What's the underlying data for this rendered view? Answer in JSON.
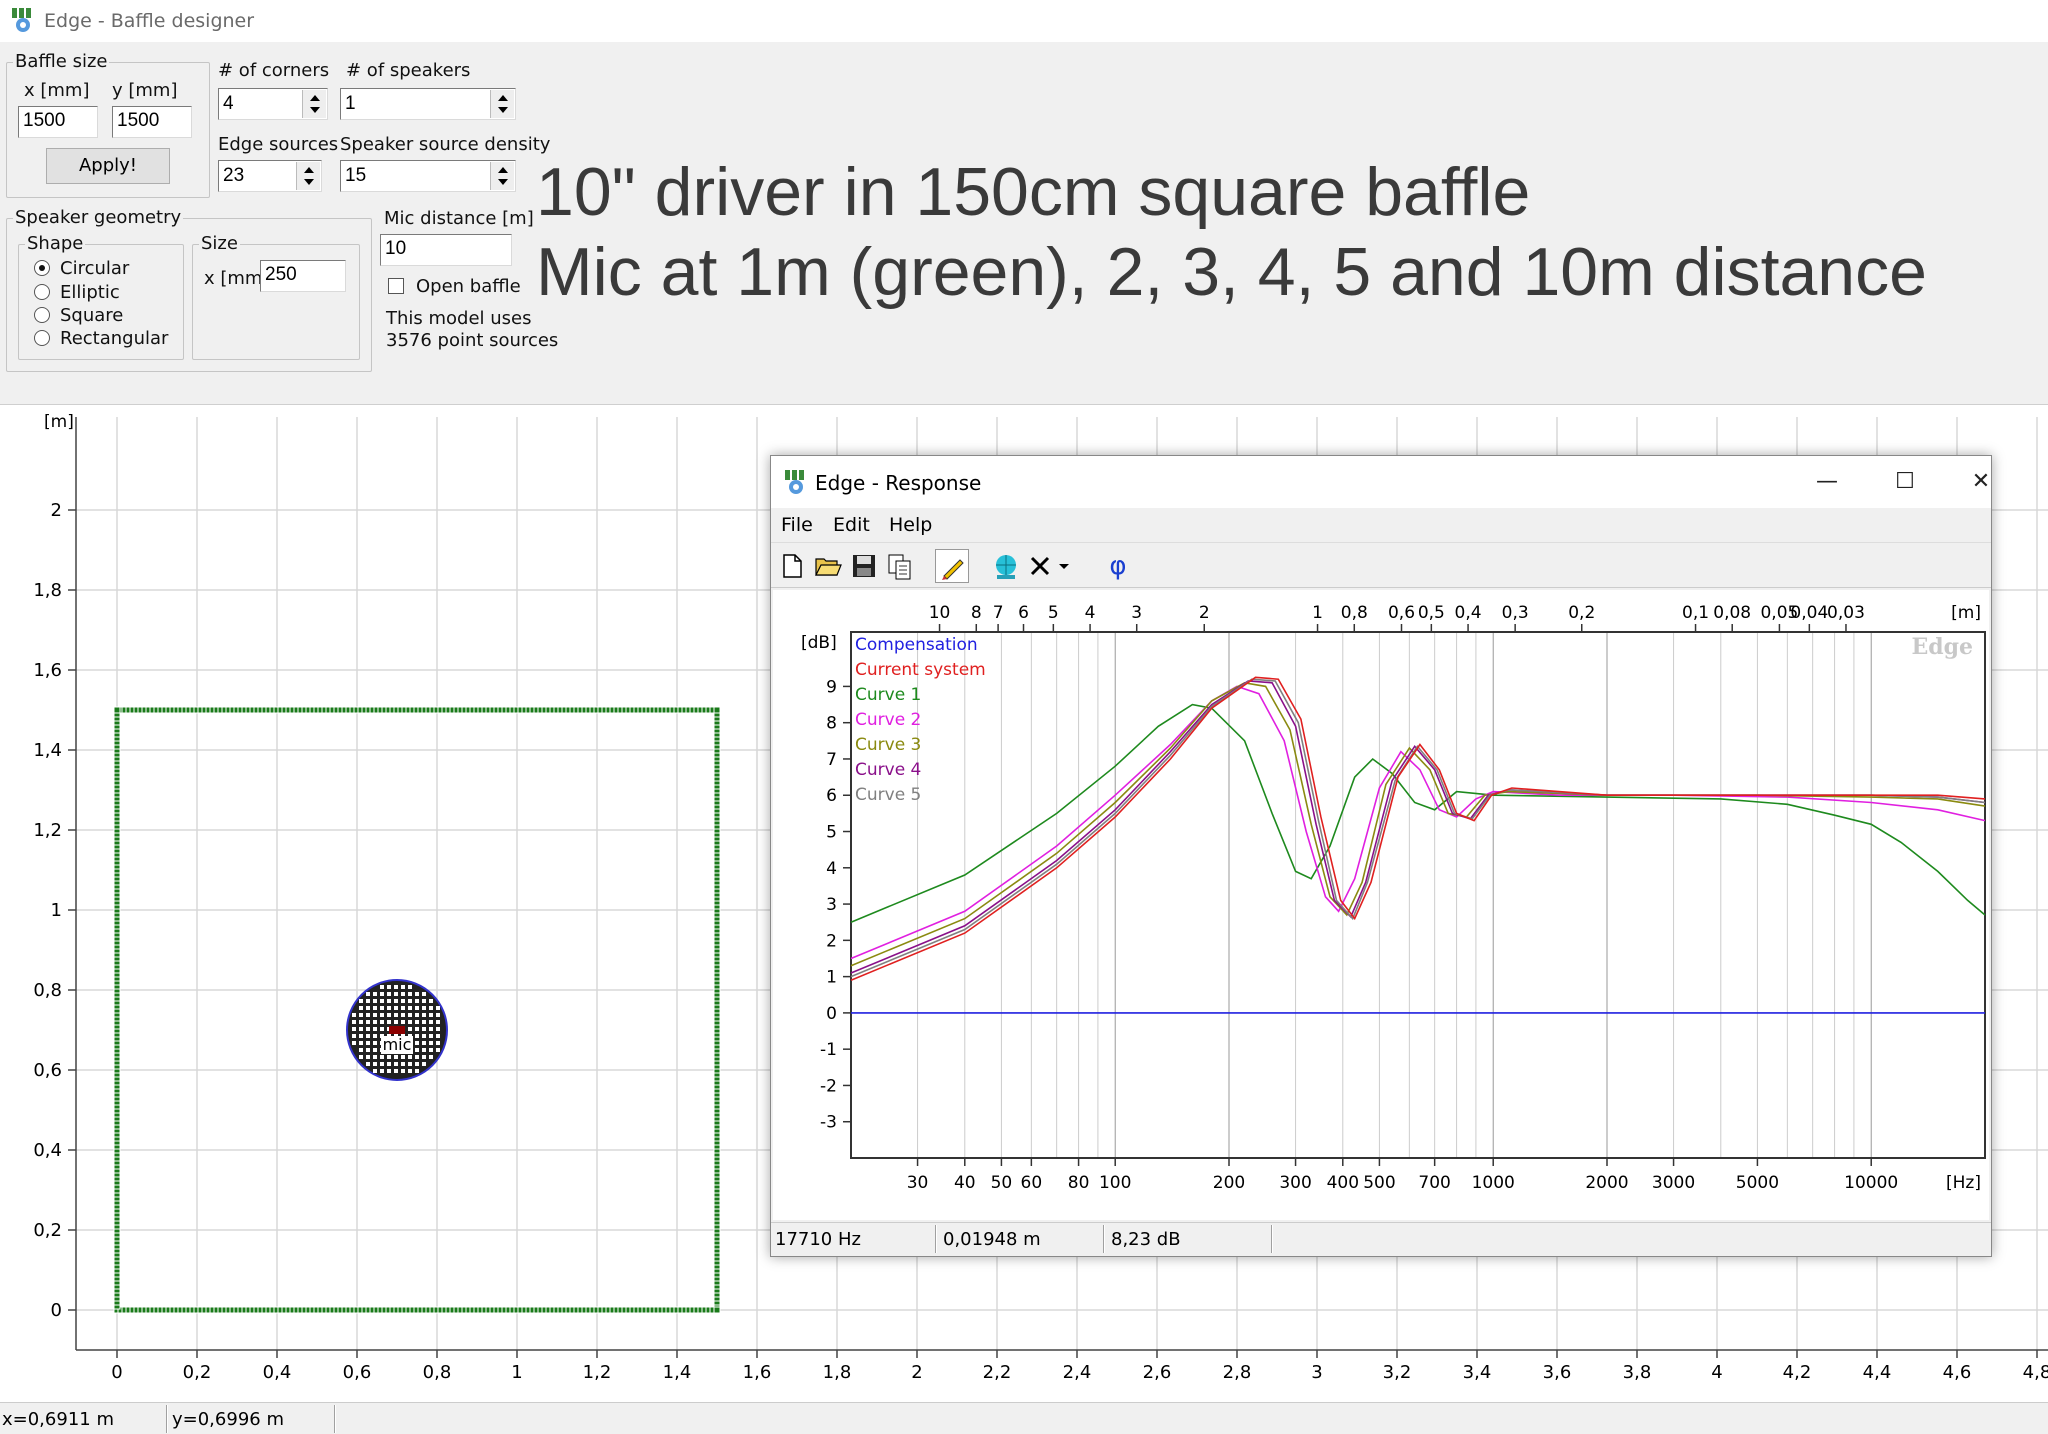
{
  "window": {
    "title": "Edge - Baffle designer"
  },
  "baffle_size": {
    "legend": "Baffle size",
    "x_label": "x [mm]",
    "y_label": "y [mm]",
    "x_value": "1500",
    "y_value": "1500",
    "apply_label": "Apply!"
  },
  "corners": {
    "label": "# of corners",
    "value": "4"
  },
  "speakers": {
    "label": "# of speakers",
    "value": "1"
  },
  "edge_sources": {
    "label": "Edge sources",
    "value": "23"
  },
  "speaker_density": {
    "label": "Speaker source density",
    "value": "15"
  },
  "speaker_geometry": {
    "legend": "Speaker geometry",
    "shape_legend": "Shape",
    "shapes": [
      {
        "label": "Circular",
        "selected": true
      },
      {
        "label": "Elliptic",
        "selected": false
      },
      {
        "label": "Square",
        "selected": false
      },
      {
        "label": "Rectangular",
        "selected": false
      }
    ],
    "size_legend": "Size",
    "size_x_label": "x [mm]",
    "size_x_value": "250"
  },
  "mic": {
    "label": "Mic distance [m]",
    "value": "10",
    "open_baffle_label": "Open baffle",
    "open_baffle_checked": false
  },
  "model_info": {
    "line1": "This model uses",
    "line2": "3576 point sources"
  },
  "annotation": {
    "line1": "10\" driver in 150cm square baffle",
    "line2": "Mic at 1m (green), 2, 3, 4, 5 and 10m distance"
  },
  "baffle_plot": {
    "y_unit": "[m]",
    "y_ticks": [
      "2",
      "1,8",
      "1,6",
      "1,4",
      "1,2",
      "1",
      "0,8",
      "0,6",
      "0,4",
      "0,2",
      "0"
    ],
    "x_ticks": [
      "0",
      "0,2",
      "0,4",
      "0,6",
      "0,8",
      "1",
      "1,2",
      "1,4",
      "1,6",
      "1,8",
      "2",
      "2,2",
      "2,4",
      "2,6",
      "2,8",
      "3",
      "3,2",
      "3,4",
      "3,6",
      "3,8",
      "4",
      "4,2",
      "4,4",
      "4,6",
      "4,8"
    ],
    "baffle_w_m": 1.5,
    "baffle_h_m": 1.5,
    "speaker_center_m": [
      0.7,
      0.7
    ],
    "speaker_diameter_m": 0.25,
    "mic_label": "mic",
    "colors": {
      "baffle": "#1a7a1a",
      "edge_red": "#e03030",
      "speaker_outline": "#3333cc"
    }
  },
  "status": {
    "x": "x=0,6911 m",
    "y": "y=0,6996 m"
  },
  "response_window": {
    "title": "Edge - Response",
    "buttons": {
      "minimize": "—",
      "maximize": "☐",
      "close": "✕"
    },
    "menu": [
      "File",
      "Edit",
      "Help"
    ],
    "status": {
      "freq": "17710 Hz",
      "wavelength": "0,01948 m",
      "level": "8,23 dB"
    },
    "tool_icons": [
      "new-icon",
      "open-icon",
      "save-icon",
      "copy-icon",
      "pen-icon",
      "globe-icon",
      "delete-icon",
      "dropdown-icon",
      "phase-icon"
    ],
    "phase_glyph": "φ"
  },
  "chart_data": {
    "type": "line",
    "watermark": "Edge",
    "ylabel": "[dB]",
    "xlabel": "[Hz]",
    "top_label": "[m]",
    "x_scale": "log",
    "xlim": [
      20,
      20000
    ],
    "ylim": [
      -4,
      10.5
    ],
    "x_ticks": [
      {
        "v": 30,
        "t": "30"
      },
      {
        "v": 40,
        "t": "40"
      },
      {
        "v": 50,
        "t": "50"
      },
      {
        "v": 60,
        "t": "60"
      },
      {
        "v": 80,
        "t": "80"
      },
      {
        "v": 100,
        "t": "100"
      },
      {
        "v": 200,
        "t": "200"
      },
      {
        "v": 300,
        "t": "300"
      },
      {
        "v": 400,
        "t": "400"
      },
      {
        "v": 500,
        "t": "500"
      },
      {
        "v": 700,
        "t": "700"
      },
      {
        "v": 1000,
        "t": "1000"
      },
      {
        "v": 2000,
        "t": "2000"
      },
      {
        "v": 3000,
        "t": "3000"
      },
      {
        "v": 5000,
        "t": "5000"
      },
      {
        "v": 10000,
        "t": "10000"
      }
    ],
    "y_ticks": [
      "9",
      "8",
      "7",
      "6",
      "5",
      "4",
      "3",
      "2",
      "1",
      "0",
      "-1",
      "-2",
      "-3"
    ],
    "wavelength_ticks": [
      {
        "f": 34.3,
        "t": "10"
      },
      {
        "f": 42.9,
        "t": "8"
      },
      {
        "f": 49,
        "t": "7"
      },
      {
        "f": 57.2,
        "t": "6"
      },
      {
        "f": 68.6,
        "t": "5"
      },
      {
        "f": 85.8,
        "t": "4"
      },
      {
        "f": 114,
        "t": "3"
      },
      {
        "f": 172,
        "t": "2"
      },
      {
        "f": 343,
        "t": "1"
      },
      {
        "f": 429,
        "t": "0,8"
      },
      {
        "f": 572,
        "t": "0,6"
      },
      {
        "f": 686,
        "t": "0,5"
      },
      {
        "f": 858,
        "t": "0,4"
      },
      {
        "f": 1143,
        "t": "0,3"
      },
      {
        "f": 1715,
        "t": "0,2"
      },
      {
        "f": 3430,
        "t": "0,1"
      },
      {
        "f": 4288,
        "t": "0,08"
      },
      {
        "f": 5717,
        "t": "0,05"
      },
      {
        "f": 6860,
        "t": "0,04"
      },
      {
        "f": 8575,
        "t": "0,03"
      }
    ],
    "legend": [
      {
        "name": "Compensation",
        "color": "#2020e0"
      },
      {
        "name": "Current system",
        "color": "#e02020"
      },
      {
        "name": "Curve 1",
        "color": "#1e8a1e"
      },
      {
        "name": "Curve 2",
        "color": "#e020e0"
      },
      {
        "name": "Curve 3",
        "color": "#8a8a10"
      },
      {
        "name": "Curve 4",
        "color": "#8a108a"
      },
      {
        "name": "Curve 5",
        "color": "#808080"
      }
    ],
    "series": [
      {
        "name": "Compensation",
        "color": "#2020e0",
        "points": [
          [
            20,
            0
          ],
          [
            20000,
            0
          ]
        ]
      },
      {
        "name": "Curve 1",
        "color": "#1e8a1e",
        "points": [
          [
            20,
            2.5
          ],
          [
            40,
            3.8
          ],
          [
            70,
            5.5
          ],
          [
            100,
            6.8
          ],
          [
            130,
            7.9
          ],
          [
            160,
            8.5
          ],
          [
            180,
            8.4
          ],
          [
            220,
            7.5
          ],
          [
            260,
            5.5
          ],
          [
            300,
            3.9
          ],
          [
            330,
            3.7
          ],
          [
            370,
            4.6
          ],
          [
            430,
            6.5
          ],
          [
            480,
            7
          ],
          [
            540,
            6.6
          ],
          [
            620,
            5.8
          ],
          [
            700,
            5.6
          ],
          [
            800,
            6.1
          ],
          [
            1000,
            6
          ],
          [
            2000,
            5.95
          ],
          [
            4000,
            5.9
          ],
          [
            6000,
            5.75
          ],
          [
            8000,
            5.45
          ],
          [
            10000,
            5.2
          ],
          [
            12000,
            4.7
          ],
          [
            15000,
            3.9
          ],
          [
            18000,
            3.1
          ],
          [
            20000,
            2.7
          ]
        ]
      },
      {
        "name": "Curve 2",
        "color": "#e020e0",
        "points": [
          [
            20,
            1.5
          ],
          [
            40,
            2.8
          ],
          [
            70,
            4.6
          ],
          [
            100,
            6
          ],
          [
            140,
            7.4
          ],
          [
            180,
            8.6
          ],
          [
            210,
            9
          ],
          [
            240,
            8.8
          ],
          [
            280,
            7.5
          ],
          [
            320,
            5
          ],
          [
            360,
            3.2
          ],
          [
            390,
            2.8
          ],
          [
            430,
            3.7
          ],
          [
            500,
            6.2
          ],
          [
            570,
            7.2
          ],
          [
            640,
            6.7
          ],
          [
            720,
            5.6
          ],
          [
            800,
            5.4
          ],
          [
            900,
            5.9
          ],
          [
            1000,
            6.1
          ],
          [
            1500,
            6
          ],
          [
            3000,
            6
          ],
          [
            6000,
            5.95
          ],
          [
            10000,
            5.8
          ],
          [
            15000,
            5.6
          ],
          [
            20000,
            5.3
          ]
        ]
      },
      {
        "name": "Curve 3",
        "color": "#8a8a10",
        "points": [
          [
            20,
            1.3
          ],
          [
            40,
            2.6
          ],
          [
            70,
            4.4
          ],
          [
            100,
            5.8
          ],
          [
            140,
            7.3
          ],
          [
            180,
            8.6
          ],
          [
            220,
            9.1
          ],
          [
            250,
            9
          ],
          [
            290,
            7.8
          ],
          [
            330,
            5.2
          ],
          [
            370,
            3.2
          ],
          [
            410,
            2.7
          ],
          [
            450,
            3.6
          ],
          [
            520,
            6.3
          ],
          [
            600,
            7.3
          ],
          [
            680,
            6.7
          ],
          [
            760,
            5.5
          ],
          [
            850,
            5.4
          ],
          [
            950,
            6
          ],
          [
            1100,
            6.1
          ],
          [
            2000,
            6
          ],
          [
            5000,
            6
          ],
          [
            10000,
            5.95
          ],
          [
            15000,
            5.9
          ],
          [
            20000,
            5.7
          ]
        ]
      },
      {
        "name": "Curve 4",
        "color": "#8a108a",
        "points": [
          [
            20,
            1.1
          ],
          [
            40,
            2.4
          ],
          [
            70,
            4.2
          ],
          [
            100,
            5.6
          ],
          [
            140,
            7.2
          ],
          [
            180,
            8.5
          ],
          [
            225,
            9.15
          ],
          [
            260,
            9.1
          ],
          [
            300,
            7.9
          ],
          [
            340,
            5.2
          ],
          [
            380,
            3.1
          ],
          [
            420,
            2.65
          ],
          [
            460,
            3.6
          ],
          [
            540,
            6.4
          ],
          [
            620,
            7.35
          ],
          [
            700,
            6.7
          ],
          [
            780,
            5.5
          ],
          [
            870,
            5.35
          ],
          [
            970,
            6
          ],
          [
            1100,
            6.15
          ],
          [
            2000,
            6
          ],
          [
            5000,
            6
          ],
          [
            10000,
            6
          ],
          [
            15000,
            5.95
          ],
          [
            20000,
            5.8
          ]
        ]
      },
      {
        "name": "Curve 5",
        "color": "#808080",
        "points": [
          [
            20,
            1
          ],
          [
            40,
            2.3
          ],
          [
            70,
            4.1
          ],
          [
            100,
            5.5
          ],
          [
            140,
            7.1
          ],
          [
            180,
            8.45
          ],
          [
            230,
            9.2
          ],
          [
            265,
            9.15
          ],
          [
            305,
            8
          ],
          [
            345,
            5.3
          ],
          [
            385,
            3.1
          ],
          [
            425,
            2.6
          ],
          [
            465,
            3.6
          ],
          [
            550,
            6.4
          ],
          [
            630,
            7.35
          ],
          [
            710,
            6.7
          ],
          [
            790,
            5.5
          ],
          [
            880,
            5.35
          ],
          [
            980,
            6
          ],
          [
            1100,
            6.15
          ],
          [
            2000,
            6
          ],
          [
            5000,
            6
          ],
          [
            10000,
            6
          ],
          [
            15000,
            5.95
          ],
          [
            20000,
            5.8
          ]
        ]
      },
      {
        "name": "Current system",
        "color": "#e02020",
        "points": [
          [
            20,
            0.9
          ],
          [
            40,
            2.2
          ],
          [
            70,
            4
          ],
          [
            100,
            5.4
          ],
          [
            140,
            7
          ],
          [
            180,
            8.4
          ],
          [
            235,
            9.25
          ],
          [
            270,
            9.2
          ],
          [
            310,
            8.1
          ],
          [
            350,
            5.4
          ],
          [
            395,
            3.1
          ],
          [
            430,
            2.6
          ],
          [
            475,
            3.6
          ],
          [
            560,
            6.5
          ],
          [
            640,
            7.4
          ],
          [
            720,
            6.7
          ],
          [
            800,
            5.5
          ],
          [
            890,
            5.3
          ],
          [
            990,
            6
          ],
          [
            1120,
            6.2
          ],
          [
            2000,
            6
          ],
          [
            5000,
            6
          ],
          [
            10000,
            6
          ],
          [
            15000,
            6
          ],
          [
            20000,
            5.9
          ]
        ]
      }
    ]
  }
}
